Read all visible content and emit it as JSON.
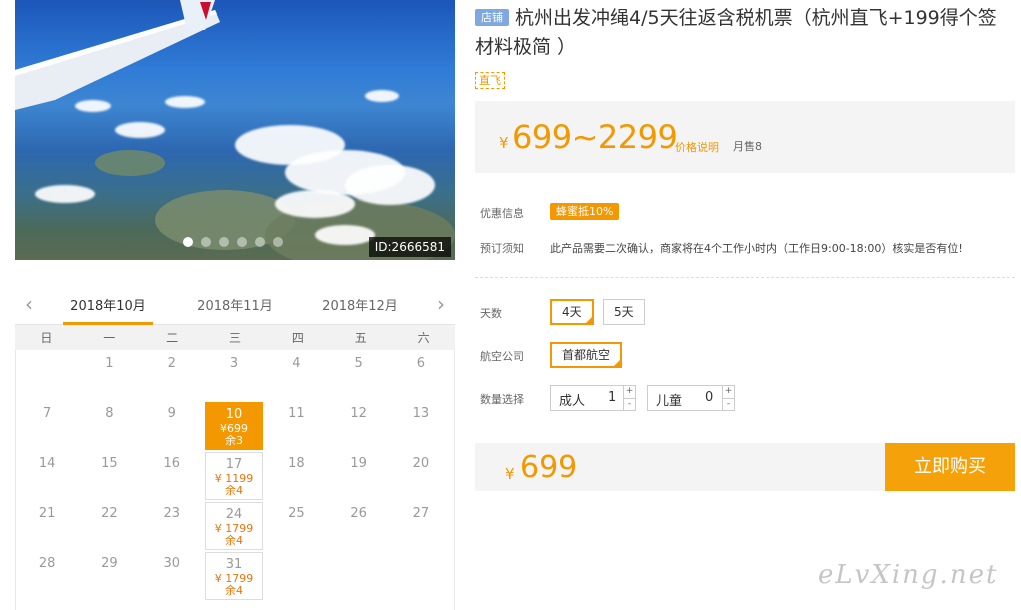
{
  "photo": {
    "id_label": "ID:2666581",
    "dot_count": 6,
    "active_dot": 0
  },
  "calendar": {
    "prev_icon": "chevron-left-icon",
    "next_icon": "chevron-right-icon",
    "months": [
      "2018年10月",
      "2018年11月",
      "2018年12月"
    ],
    "active_month": 0,
    "weekdays": [
      "日",
      "一",
      "二",
      "三",
      "四",
      "五",
      "六"
    ],
    "weeks": [
      [
        null,
        {
          "d": "1"
        },
        {
          "d": "2"
        },
        {
          "d": "3"
        },
        {
          "d": "4"
        },
        {
          "d": "5"
        },
        {
          "d": "6"
        }
      ],
      [
        {
          "d": "7"
        },
        {
          "d": "8"
        },
        {
          "d": "9"
        },
        {
          "d": "10",
          "price": "¥699",
          "rem": "余3",
          "selected": true
        },
        {
          "d": "11"
        },
        {
          "d": "12"
        },
        {
          "d": "13"
        }
      ],
      [
        {
          "d": "14"
        },
        {
          "d": "15"
        },
        {
          "d": "16"
        },
        {
          "d": "17",
          "price": "¥ 1199",
          "rem": "余4"
        },
        {
          "d": "18"
        },
        {
          "d": "19"
        },
        {
          "d": "20"
        }
      ],
      [
        {
          "d": "21"
        },
        {
          "d": "22"
        },
        {
          "d": "23"
        },
        {
          "d": "24",
          "price": "¥ 1799",
          "rem": "余4"
        },
        {
          "d": "25"
        },
        {
          "d": "26"
        },
        {
          "d": "27"
        }
      ],
      [
        {
          "d": "28"
        },
        {
          "d": "29"
        },
        {
          "d": "30"
        },
        {
          "d": "31",
          "price": "¥ 1799",
          "rem": "余4"
        },
        null,
        null,
        null
      ]
    ]
  },
  "product": {
    "shop_tag": "店铺",
    "title": "杭州出发冲绳4/5天往返含税机票（杭州直飞+199得个签 材料极简 ）",
    "direct_tag": "直飞",
    "price_symbol": "¥",
    "price_range": "699~2299",
    "price_explain": "价格说明",
    "monthly_sales": "月售8"
  },
  "info": {
    "promo_label": "优惠信息",
    "promo_badge": "蜂蜜抵10%",
    "notice_label": "预订须知",
    "notice_text": "此产品需要二次确认，商家将在4个工作小时内（工作日9:00-18:00）核实是否有位!"
  },
  "options": {
    "days_label": "天数",
    "days": [
      "4天",
      "5天"
    ],
    "days_selected": 0,
    "airline_label": "航空公司",
    "airline": "首都航空",
    "qty_label": "数量选择",
    "adult_label": "成人",
    "adult_value": "1",
    "child_label": "儿童",
    "child_value": "0",
    "plus": "+",
    "minus": "-"
  },
  "purchase": {
    "symbol": "¥",
    "total": "699",
    "buy_label": "立即购买"
  },
  "watermark": "eLvXing.net",
  "colors": {
    "accent": "#f39800",
    "tag_blue": "#7fa8e0"
  }
}
